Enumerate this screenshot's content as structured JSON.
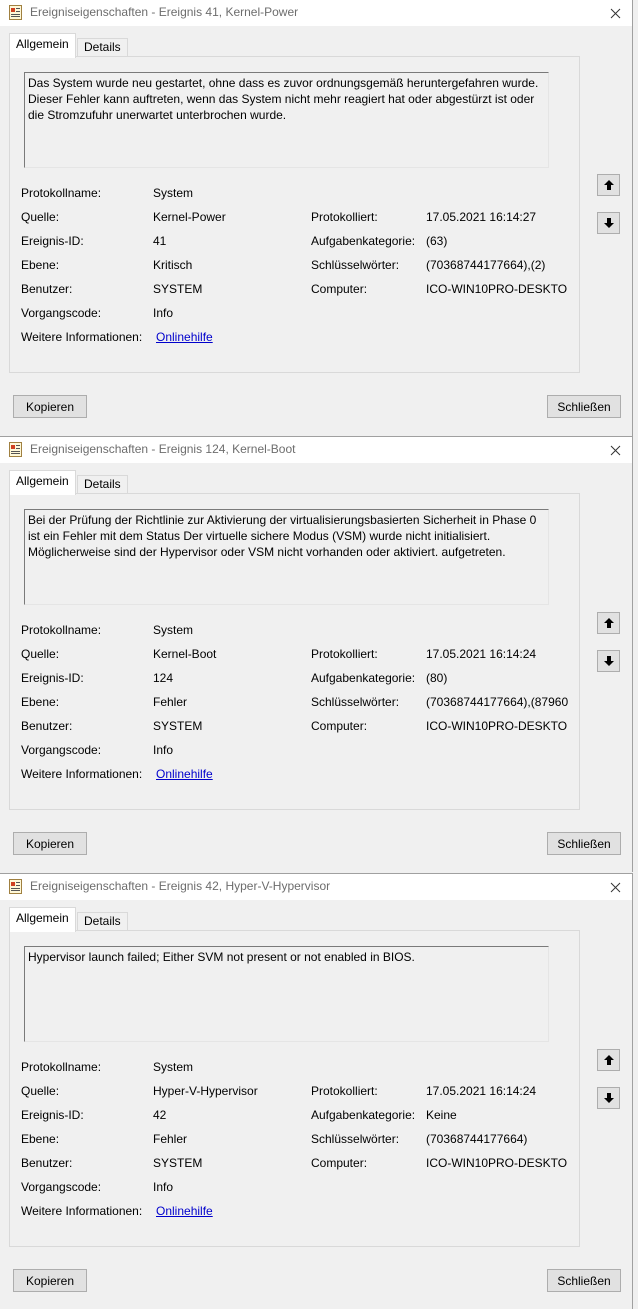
{
  "windows": [
    {
      "title": "Ereigniseigenschaften - Ereignis 41, Kernel-Power",
      "tabs": {
        "general": "Allgemein",
        "details": "Details"
      },
      "description": "Das System wurde neu gestartet, ohne dass es zuvor ordnungsgemäß heruntergefahren wurde. Dieser Fehler kann auftreten, wenn das System nicht mehr reagiert hat oder abgestürzt ist oder die Stromzufuhr unerwartet unterbrochen wurde.",
      "labels": {
        "protocol_name": "Protokollname:",
        "source": "Quelle:",
        "event_id": "Ereignis-ID:",
        "level": "Ebene:",
        "user": "Benutzer:",
        "opcode": "Vorgangscode:",
        "more_info": "Weitere Informationen:",
        "logged": "Protokolliert:",
        "task_category": "Aufgabenkategorie:",
        "keywords": "Schlüsselwörter:",
        "computer": "Computer:"
      },
      "values": {
        "protocol_name": "System",
        "source": "Kernel-Power",
        "event_id": "41",
        "level": "Kritisch",
        "user": "SYSTEM",
        "opcode": "Info",
        "more_info_link": "Onlinehilfe",
        "logged": "17.05.2021 16:14:27",
        "task_category": "(63)",
        "keywords": "(70368744177664),(2)",
        "computer": "ICO-WIN10PRO-DESKTO"
      },
      "buttons": {
        "copy": "Kopieren",
        "close": "Schließen"
      }
    },
    {
      "title": "Ereigniseigenschaften - Ereignis 124, Kernel-Boot",
      "tabs": {
        "general": "Allgemein",
        "details": "Details"
      },
      "description": "Bei der Prüfung der Richtlinie zur Aktivierung der virtualisierungsbasierten Sicherheit in Phase 0 ist ein Fehler mit dem Status Der virtuelle sichere Modus (VSM) wurde nicht initialisiert. Möglicherweise sind der Hypervisor oder VSM nicht vorhanden oder aktiviert. aufgetreten.",
      "labels": {
        "protocol_name": "Protokollname:",
        "source": "Quelle:",
        "event_id": "Ereignis-ID:",
        "level": "Ebene:",
        "user": "Benutzer:",
        "opcode": "Vorgangscode:",
        "more_info": "Weitere Informationen:",
        "logged": "Protokolliert:",
        "task_category": "Aufgabenkategorie:",
        "keywords": "Schlüsselwörter:",
        "computer": "Computer:"
      },
      "values": {
        "protocol_name": "System",
        "source": "Kernel-Boot",
        "event_id": "124",
        "level": "Fehler",
        "user": "SYSTEM",
        "opcode": "Info",
        "more_info_link": "Onlinehilfe",
        "logged": "17.05.2021 16:14:24",
        "task_category": "(80)",
        "keywords": "(70368744177664),(87960",
        "computer": "ICO-WIN10PRO-DESKTO"
      },
      "buttons": {
        "copy": "Kopieren",
        "close": "Schließen"
      }
    },
    {
      "title": "Ereigniseigenschaften - Ereignis 42, Hyper-V-Hypervisor",
      "tabs": {
        "general": "Allgemein",
        "details": "Details"
      },
      "description": "Hypervisor launch failed; Either SVM not present or not enabled in BIOS.",
      "labels": {
        "protocol_name": "Protokollname:",
        "source": "Quelle:",
        "event_id": "Ereignis-ID:",
        "level": "Ebene:",
        "user": "Benutzer:",
        "opcode": "Vorgangscode:",
        "more_info": "Weitere Informationen:",
        "logged": "Protokolliert:",
        "task_category": "Aufgabenkategorie:",
        "keywords": "Schlüsselwörter:",
        "computer": "Computer:"
      },
      "values": {
        "protocol_name": "System",
        "source": "Hyper-V-Hypervisor",
        "event_id": "42",
        "level": "Fehler",
        "user": "SYSTEM",
        "opcode": "Info",
        "more_info_link": "Onlinehilfe",
        "logged": "17.05.2021 16:14:24",
        "task_category": "Keine",
        "keywords": "(70368744177664)",
        "computer": "ICO-WIN10PRO-DESKTO"
      },
      "buttons": {
        "copy": "Kopieren",
        "close": "Schließen"
      }
    }
  ],
  "icons": {
    "app": "event-viewer-icon",
    "close": "close-icon",
    "up": "arrow-up-icon",
    "down": "arrow-down-icon"
  },
  "colors": {
    "link": "#0000cc",
    "title_text": "#6d6d6d",
    "window_bg": "#f0f0f0"
  }
}
